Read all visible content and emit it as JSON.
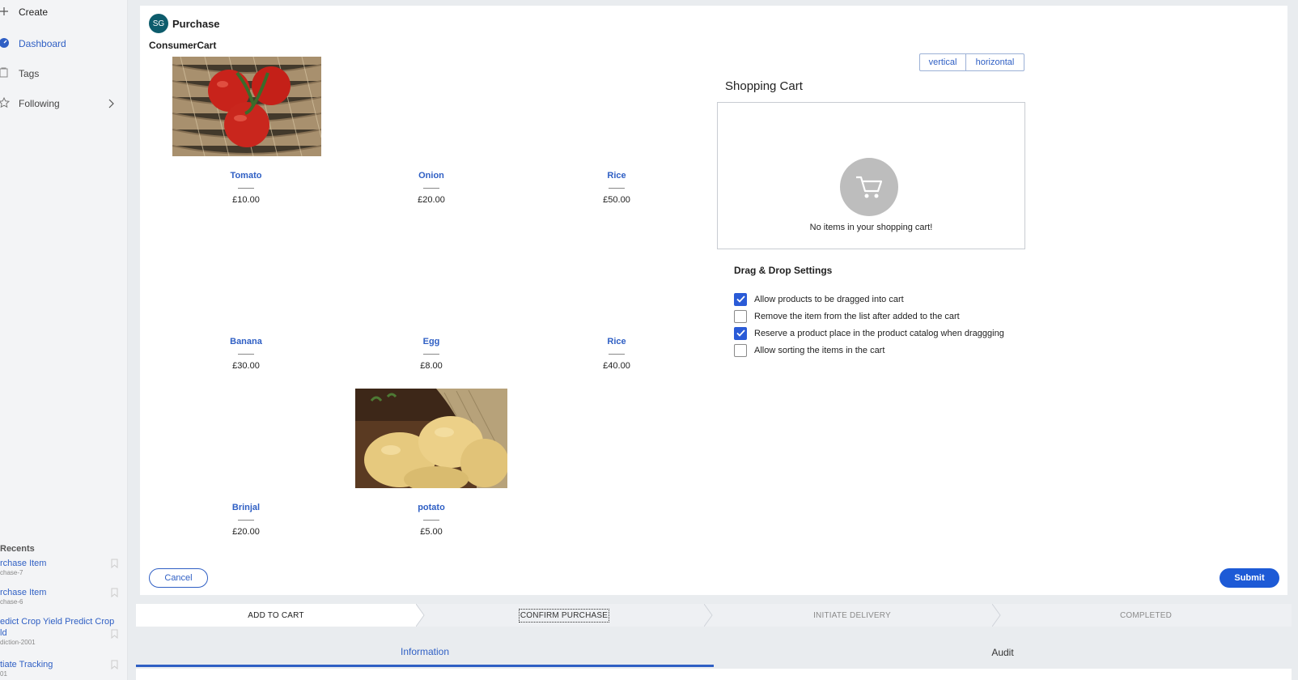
{
  "sidebar": {
    "create": "Create",
    "dashboard": "Dashboard",
    "tags": "Tags",
    "following": "Following",
    "recents_title": "Recents",
    "recents": [
      {
        "title": "rchase Item",
        "sub": "chase-7"
      },
      {
        "title": "rchase Item",
        "sub": "chase-6"
      },
      {
        "title": "edict Crop Yield Predict Crop",
        "title2": "ld",
        "sub": "diction-2001"
      },
      {
        "title": "tiate Tracking",
        "sub": "01"
      }
    ]
  },
  "header": {
    "avatar": "SG",
    "title": "Purchase"
  },
  "section_title": "ConsumerCart",
  "products": [
    {
      "name": "Tomato",
      "price": "£10.00"
    },
    {
      "name": "Onion",
      "price": "£20.00"
    },
    {
      "name": "Rice",
      "price": "£50.00"
    },
    {
      "name": "Banana",
      "price": "£30.00"
    },
    {
      "name": "Egg",
      "price": "£8.00"
    },
    {
      "name": "Rice",
      "price": "£40.00"
    },
    {
      "name": "Brinjal",
      "price": "£20.00"
    },
    {
      "name": "potato",
      "price": "£5.00"
    }
  ],
  "layout_toggle": {
    "vertical": "vertical",
    "horizontal": "horizontal"
  },
  "cart": {
    "title": "Shopping Cart",
    "empty": "No items in your shopping cart!"
  },
  "dd_settings": {
    "title": "Drag & Drop Settings",
    "options": [
      {
        "label": "Allow products to be dragged into cart",
        "checked": true
      },
      {
        "label": "Remove the item from the list after added to the cart",
        "checked": false
      },
      {
        "label": "Reserve a product place in the product catalog when draggging",
        "checked": true
      },
      {
        "label": "Allow sorting the items in the cart",
        "checked": false
      }
    ]
  },
  "actions": {
    "cancel": "Cancel",
    "submit": "Submit"
  },
  "stages": [
    "ADD TO CART",
    "CONFIRM PURCHASE",
    "INITIATE DELIVERY",
    "COMPLETED"
  ],
  "tabs": {
    "information": "Information",
    "audit": "Audit"
  },
  "colors": {
    "accent": "#2f5fc4",
    "submit": "#1d5ad6",
    "avatar": "#0d5c6c",
    "checkbox_on": "#2a5bd7"
  }
}
